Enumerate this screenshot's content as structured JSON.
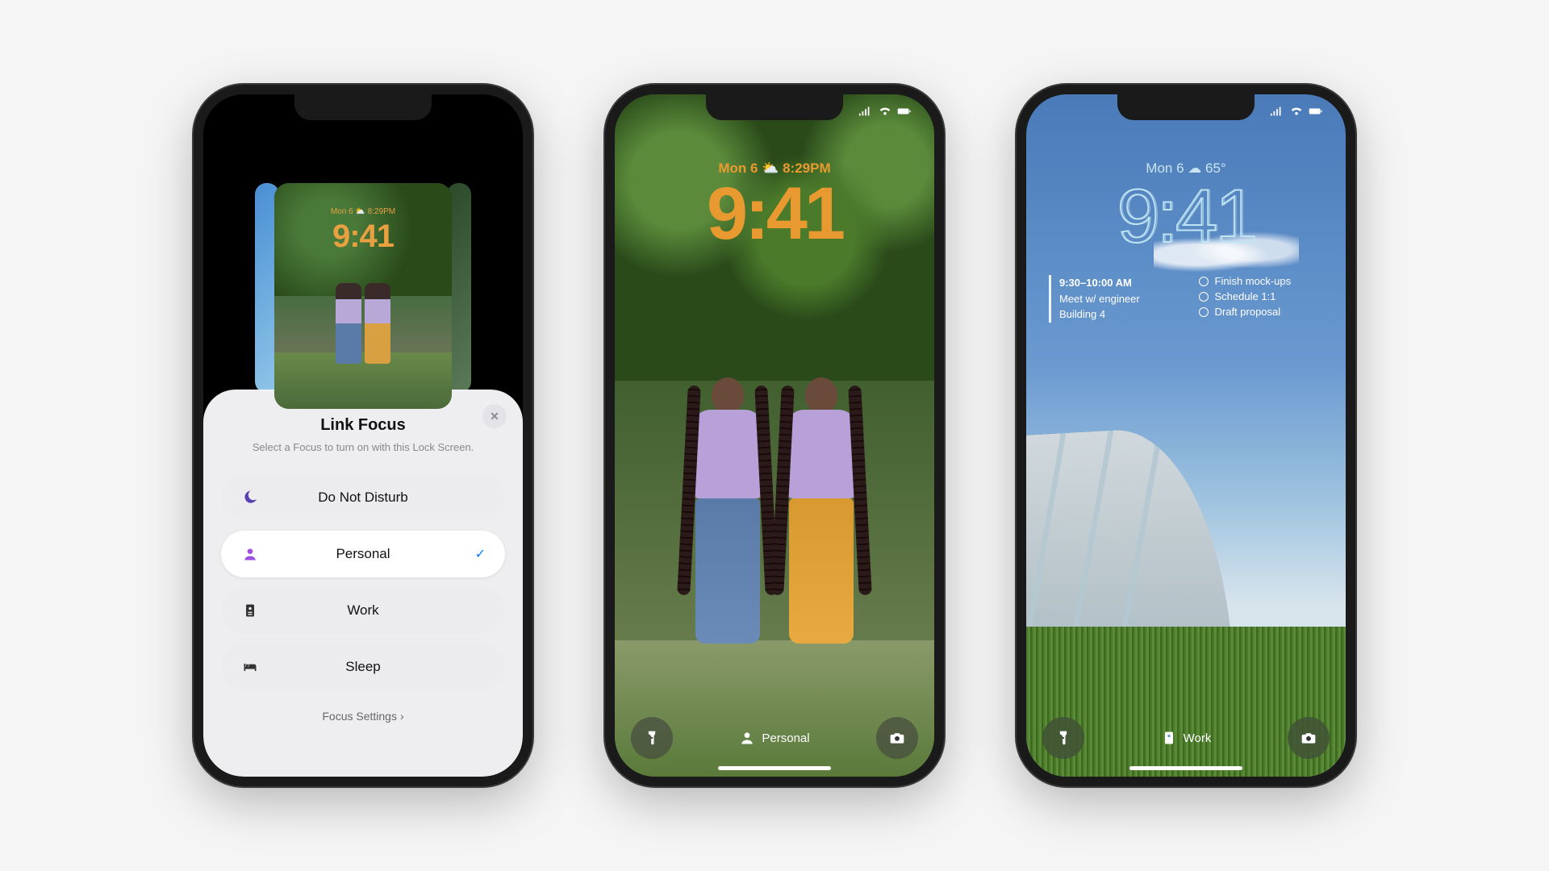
{
  "phone1": {
    "preview": {
      "date_line": "Mon 6  ⛅  8:29PM",
      "time": "9:41"
    },
    "sheet": {
      "title": "Link Focus",
      "subtitle": "Select a Focus to turn on with this Lock Screen.",
      "items": [
        {
          "icon": "moon-icon",
          "label": "Do Not Disturb",
          "selected": false
        },
        {
          "icon": "person-icon",
          "label": "Personal",
          "selected": true
        },
        {
          "icon": "badge-icon",
          "label": "Work",
          "selected": false
        },
        {
          "icon": "bed-icon",
          "label": "Sleep",
          "selected": false
        }
      ],
      "footer": "Focus Settings"
    }
  },
  "phone2": {
    "date_line": "Mon 6  ⛅  8:29PM",
    "time": "9:41",
    "focus_label": "Personal"
  },
  "phone3": {
    "date_line": "Mon 6  ☁  65°",
    "time": "9:41",
    "calendar": {
      "time_range": "9:30–10:00 AM",
      "title": "Meet w/ engineer",
      "location": "Building 4"
    },
    "reminders": [
      "Finish mock-ups",
      "Schedule 1:1",
      "Draft proposal"
    ],
    "focus_label": "Work"
  }
}
